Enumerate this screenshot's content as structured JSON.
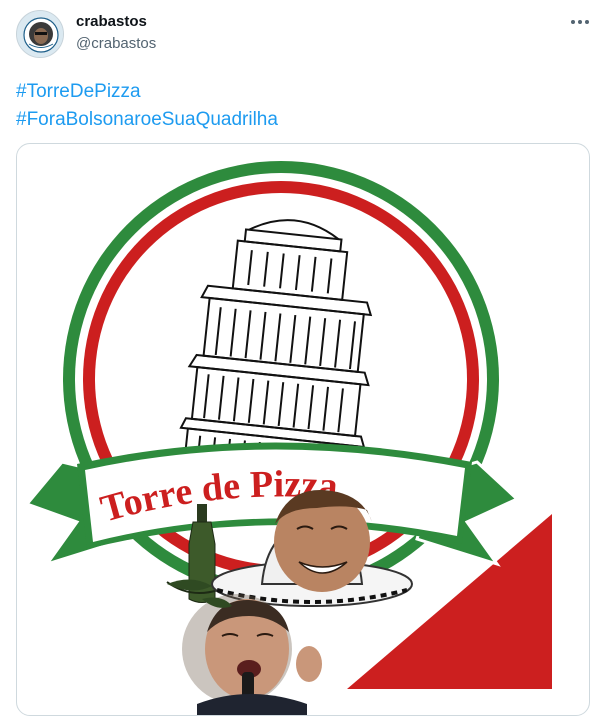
{
  "tweet": {
    "author_name": "crabastos",
    "author_handle": "@crabastos",
    "hashtags": [
      "#TorreDePizza",
      "#ForaBolsonaroeSuaQuadrilha"
    ]
  },
  "media": {
    "banner_text": "Torre de Pizza"
  },
  "icons": {
    "more": "more-options-icon"
  },
  "colors": {
    "link": "#1d9bf0",
    "green": "#2e8b3d",
    "red": "#cc1f1f"
  }
}
